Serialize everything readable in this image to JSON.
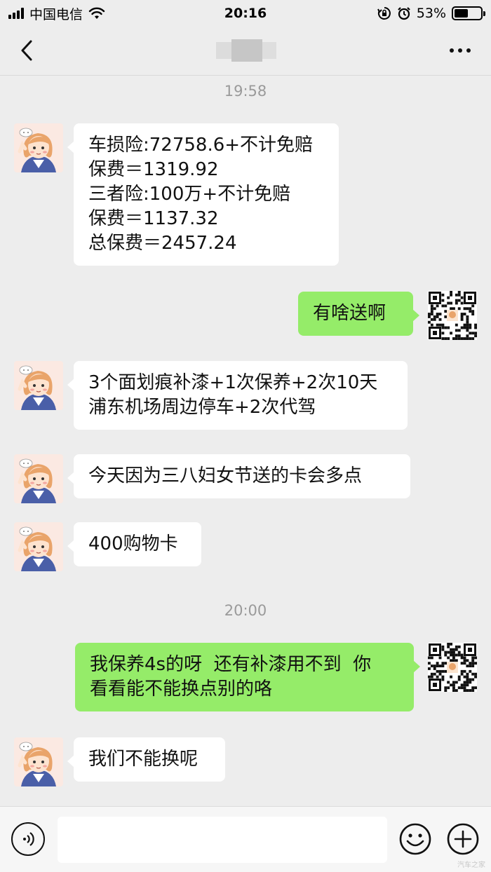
{
  "status_bar": {
    "carrier": "中国电信",
    "time": "20:16",
    "battery": "53%",
    "battery_level": 0.53,
    "icons": [
      "signal-icon",
      "wifi-icon",
      "rotation-lock-icon",
      "alarm-icon",
      "battery-icon"
    ]
  },
  "nav": {
    "back_icon": "chevron-left-icon",
    "more_icon": "more-dots-icon"
  },
  "chat": {
    "timestamps": [
      "19:58",
      "20:00"
    ],
    "messages": [
      {
        "from": "them",
        "text": "车损险:72758.6+不计免赔\n保费＝1319.92\n三者险:100万+不计免赔\n保费＝1137.32\n总保费＝2457.24"
      },
      {
        "from": "me",
        "text": "有啥送啊"
      },
      {
        "from": "them",
        "text": "3个面划痕补漆+1次保养+2次10天\n浦东机场周边停车+2次代驾"
      },
      {
        "from": "them",
        "text": "今天因为三八妇女节送的卡会多点"
      },
      {
        "from": "them",
        "text": "400购物卡"
      },
      {
        "from": "me",
        "text": "我保养4s的呀  还有补漆用不到  你\n看看能不能换点别的咯"
      },
      {
        "from": "them",
        "text": "我们不能换呢"
      }
    ]
  },
  "input_bar": {
    "placeholder": "",
    "icons": [
      "voice-icon",
      "emoji-icon",
      "plus-icon"
    ]
  },
  "colors": {
    "background": "#ededed",
    "bubble_in": "#ffffff",
    "bubble_out": "#95ec69",
    "timestamp": "#9a9a9a"
  },
  "watermark": "汽车之家"
}
